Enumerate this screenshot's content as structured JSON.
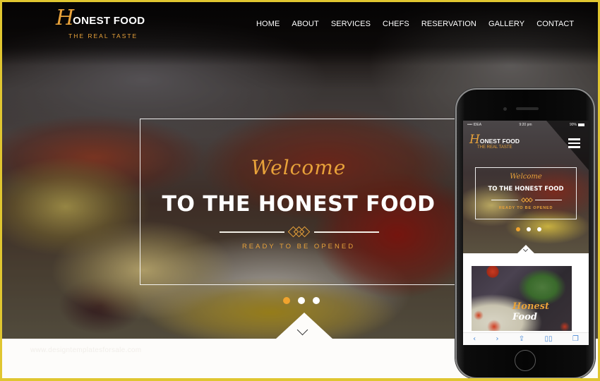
{
  "site": {
    "logo_initial": "H",
    "logo_name": "ONEST FOOD",
    "tagline": "THE REAL TASTE"
  },
  "nav": {
    "items": [
      {
        "label": "HOME"
      },
      {
        "label": "ABOUT"
      },
      {
        "label": "SERVICES"
      },
      {
        "label": "CHEFS"
      },
      {
        "label": "RESERVATION"
      },
      {
        "label": "GALLERY"
      },
      {
        "label": "CONTACT"
      }
    ]
  },
  "hero": {
    "script_heading": "Welcome",
    "title": "TO THE HONEST FOOD",
    "subtitle": "READY TO BE OPENED",
    "slides": {
      "count": 3,
      "active_index": 0
    },
    "scroll_icon": "chevron-down-icon"
  },
  "watermark": "www.designtemplatesforsale.com",
  "phone": {
    "status_bar": {
      "carrier": "•••• IDEA",
      "time": "9:20 pm",
      "battery": "90%"
    },
    "logo_initial": "H",
    "logo_name": "ONEST FOOD",
    "tagline": "THE REAL TASTE",
    "menu_icon": "hamburger-icon",
    "script_heading": "Welcome",
    "title": "TO THE HONEST FOOD",
    "subtitle": "READY TO BE OPENED",
    "slides": {
      "count": 3,
      "active_index": 0
    },
    "image_caption_initial": "Honest",
    "image_caption": "Food",
    "toolbar": {
      "back": "‹",
      "forward": "›",
      "share": "⇪",
      "bookmarks": "▯▯",
      "tabs": "❐"
    }
  },
  "colors": {
    "accent": "#e8a23a",
    "frame_border": "#e0c630",
    "dot_active": "#f0a32e",
    "text_light": "#ffffff"
  }
}
